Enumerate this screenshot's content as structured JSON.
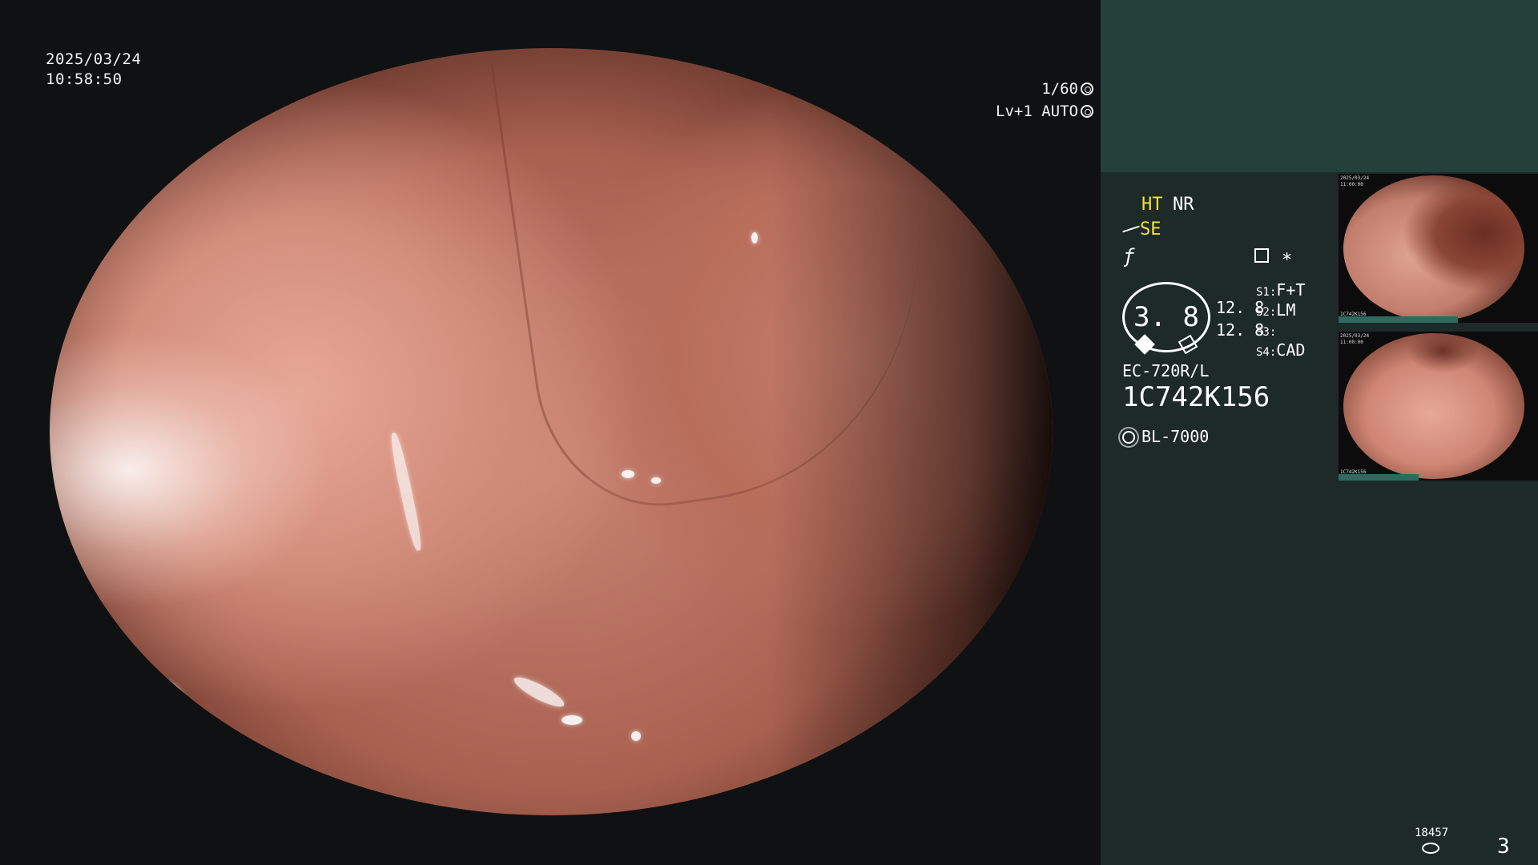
{
  "overlay": {
    "date": "2025/03/24",
    "time": "10:58:50",
    "shutter": "1/60",
    "level": "Lv+1 AUTO"
  },
  "panel": {
    "ht": "HT",
    "nr": "NR",
    "se": "SE",
    "se_icon": "scope-tip-icon",
    "f_icon": "wave-icon",
    "settings_icon": "settings-icon",
    "star": "∗",
    "gauge_value": "3. 8",
    "zoom_top": "12. 8",
    "zoom_bottom": "12. 8",
    "s1_key": "S1:",
    "s1_val": "F+T",
    "s2_key": "S2:",
    "s2_val": "LM",
    "s3_key": "S3:",
    "s3_val": "",
    "s4_key": "S4:",
    "s4_val": "CAD",
    "scope_model": "EC-720R/L",
    "serial": "1C742K156",
    "light_source": "BL-7000",
    "light_icon": "sun-icon",
    "counter": "18457",
    "page": "3"
  },
  "thumbnails": [
    {
      "date": "2025/03/24",
      "time": "11:00:00",
      "serial": "1C742K156",
      "progress": 0.6
    },
    {
      "date": "2025/03/24",
      "time": "11:00:00",
      "serial": "1C742K156",
      "progress": 0.4
    }
  ],
  "colors": {
    "panel_bg": "#1d2a28",
    "panel_top": "#23403b",
    "accent_yellow": "#f5e043"
  }
}
